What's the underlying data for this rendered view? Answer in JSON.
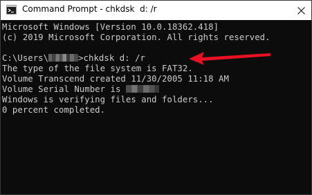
{
  "window": {
    "title": "Command Prompt - chkdsk  d: /r",
    "icon": "command-prompt-icon",
    "close_icon": "close-icon"
  },
  "console": {
    "lines": [
      "Microsoft Windows [Version 10.0.18362.418]",
      "(c) 2019 Microsoft Corporation. All rights reserved.",
      "",
      "",
      "The type of the file system is FAT32.",
      "Volume Transcend created 11/30/2005 11:18 AM",
      "",
      "Windows is verifying files and folders...",
      "0 percent completed."
    ],
    "prompt_prefix": "C:\\Users\\",
    "prompt_command": ">chkdsk d: /r",
    "serial_label": "Volume Serial Number is "
  },
  "colors": {
    "console_bg": "#0c0c0c",
    "console_text": "#cccccc",
    "arrow": "#e81123"
  }
}
